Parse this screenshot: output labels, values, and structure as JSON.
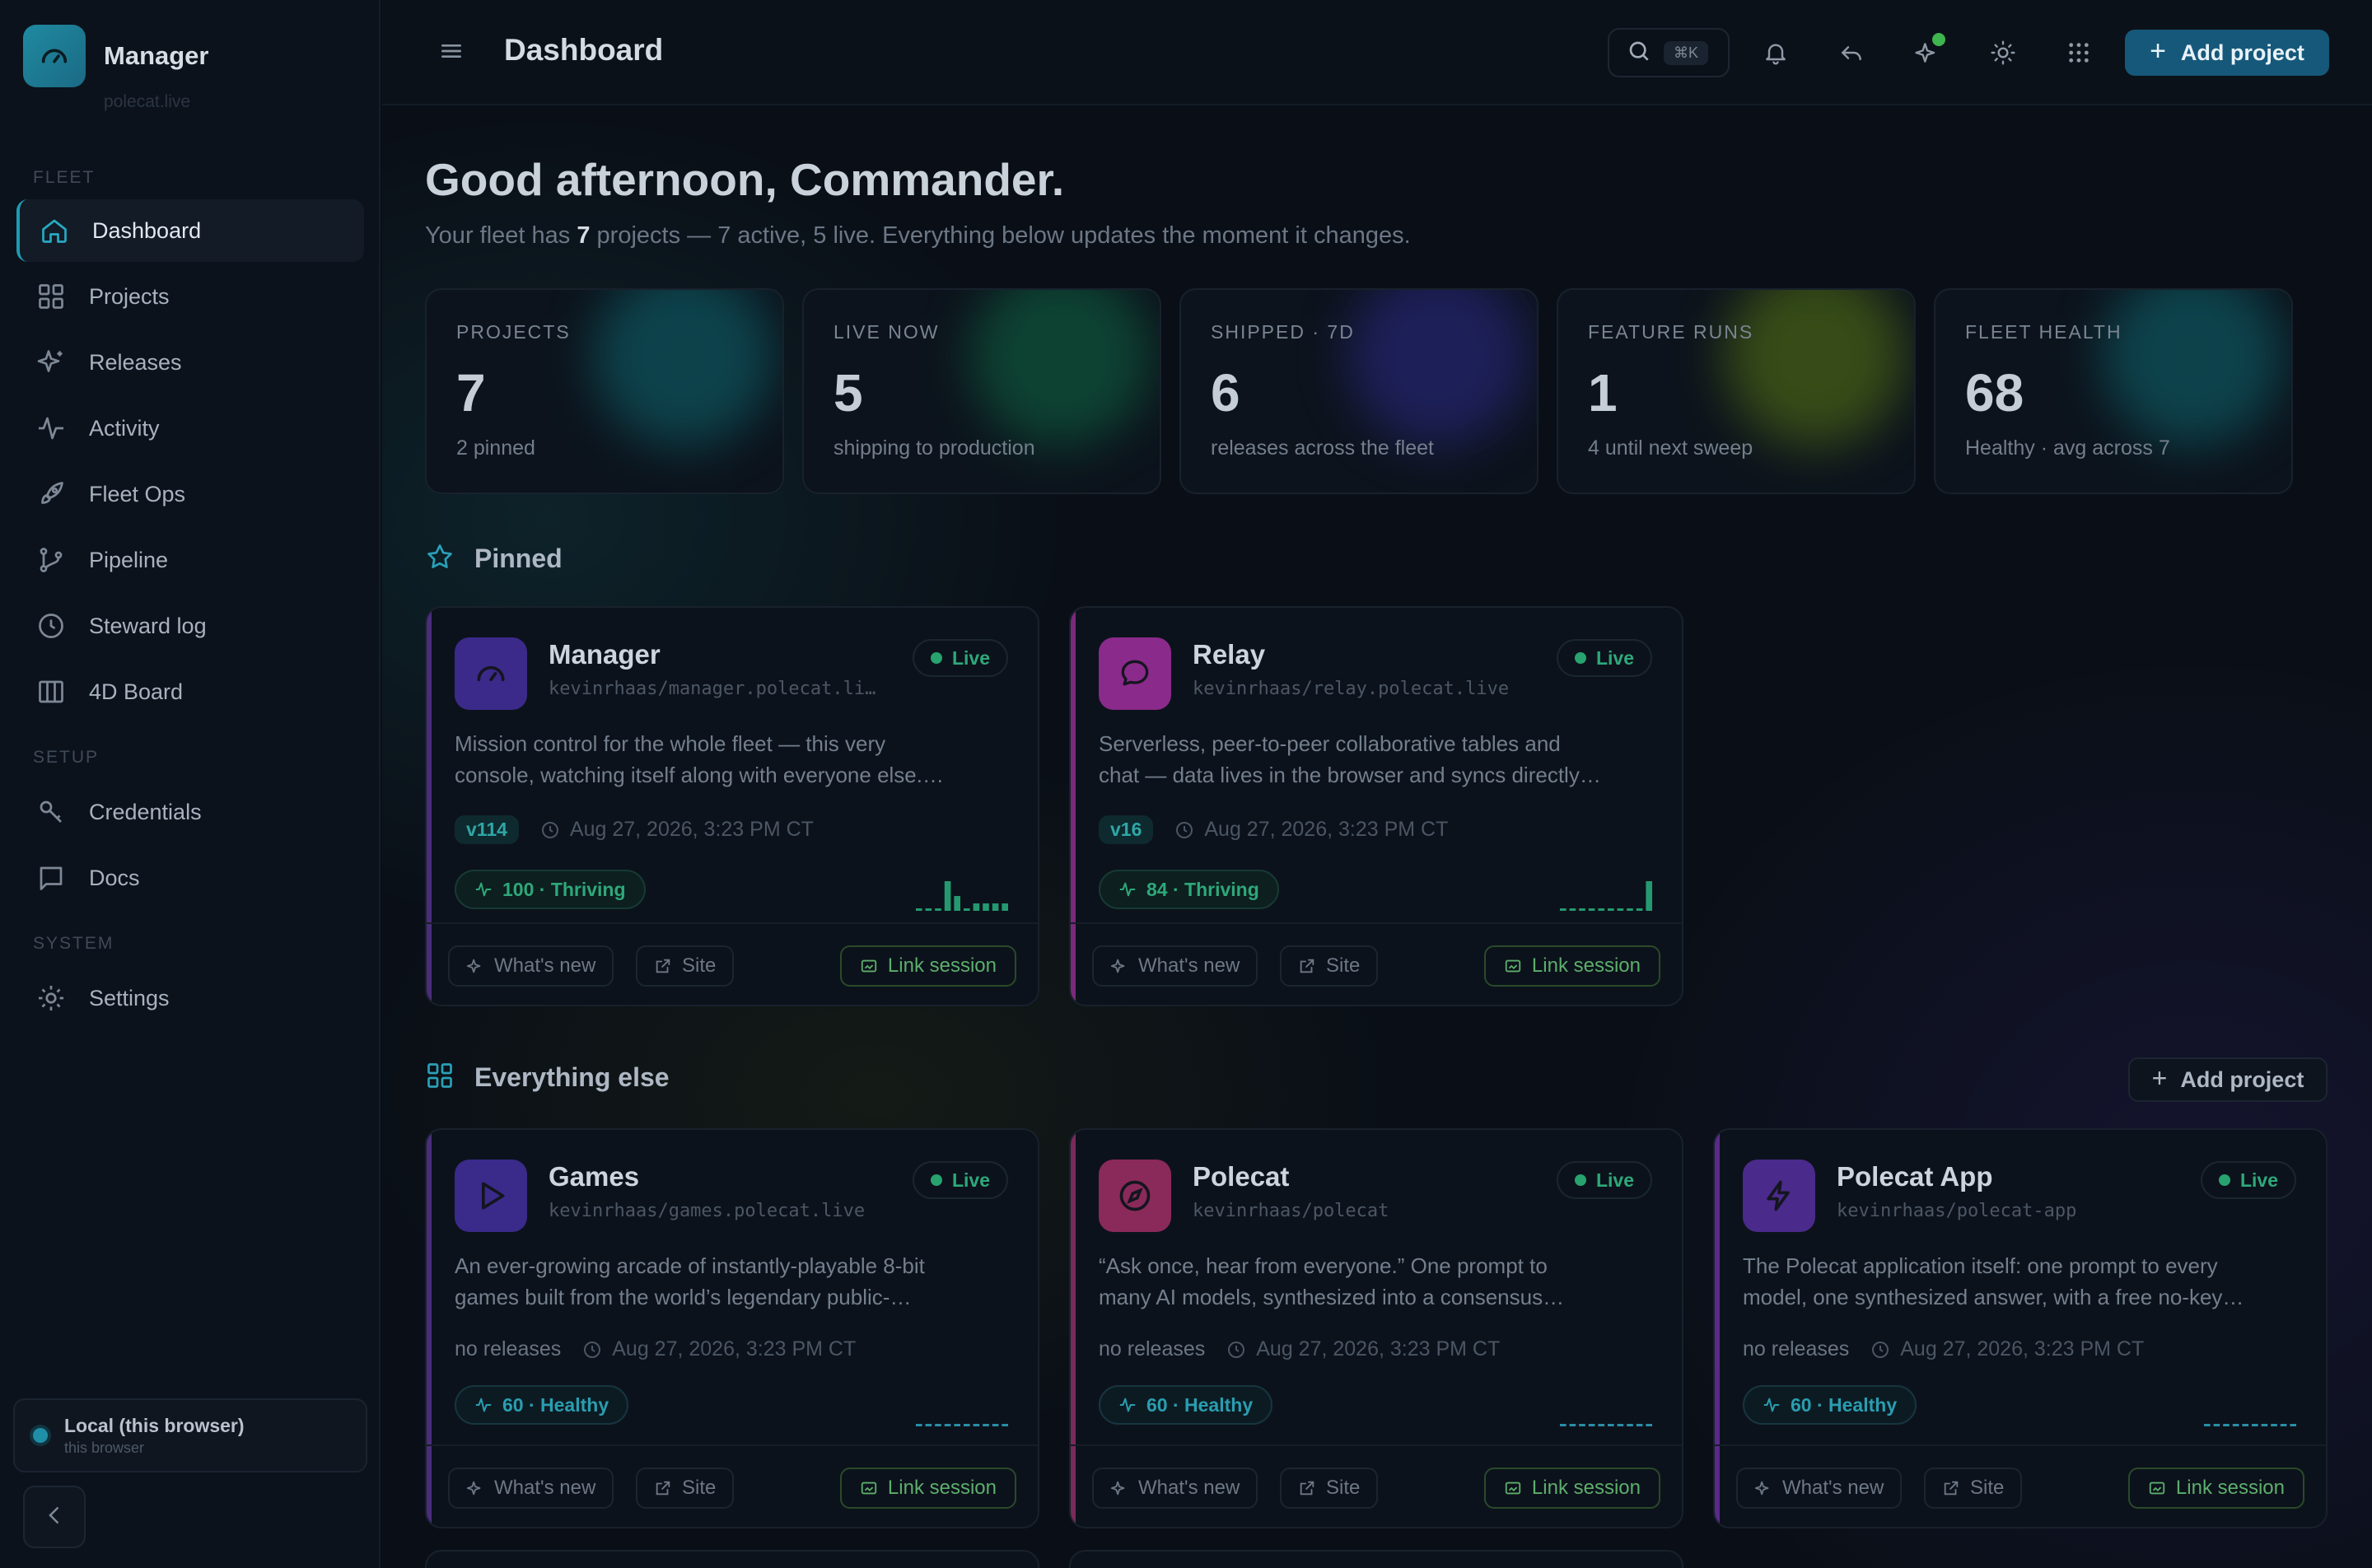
{
  "brand": {
    "name": "Manager",
    "sub": "polecat.live",
    "icon": "gauge-icon"
  },
  "nav": {
    "sections": {
      "fleet": "FLEET",
      "setup": "SETUP",
      "system": "SYSTEM"
    },
    "items": [
      {
        "label": "Dashboard",
        "icon": "home-icon",
        "active": true
      },
      {
        "label": "Projects",
        "icon": "grid-icon"
      },
      {
        "label": "Releases",
        "icon": "sparkle-icon"
      },
      {
        "label": "Activity",
        "icon": "activity-icon"
      },
      {
        "label": "Fleet Ops",
        "icon": "rocket-icon"
      },
      {
        "label": "Pipeline",
        "icon": "branch-icon"
      },
      {
        "label": "Steward log",
        "icon": "clock-icon"
      },
      {
        "label": "4D Board",
        "icon": "columns-icon"
      },
      {
        "label": "Credentials",
        "icon": "key-icon"
      },
      {
        "label": "Docs",
        "icon": "chat-square-icon"
      },
      {
        "label": "Settings",
        "icon": "gear-icon"
      }
    ]
  },
  "local": {
    "title": "Local (this browser)",
    "sub": "this browser"
  },
  "topbar": {
    "title": "Dashboard",
    "search_kbd": "⌘K",
    "add_project": "Add project"
  },
  "greeting": {
    "title": "Good afternoon, Commander.",
    "sub_pre": "Your fleet has ",
    "sub_count": "7",
    "sub_post": " projects — 7 active, 5 live. Everything below updates the moment it changes."
  },
  "stats": [
    {
      "label": "PROJECTS",
      "value": "7",
      "desc": "2 pinned",
      "glow": "#0f6a73"
    },
    {
      "label": "LIVE NOW",
      "value": "5",
      "desc": "shipping to production",
      "glow": "#0f6a45"
    },
    {
      "label": "SHIPPED · 7D",
      "value": "6",
      "desc": "releases across the fleet",
      "glow": "#2c2a8a"
    },
    {
      "label": "FEATURE RUNS",
      "value": "1",
      "desc": "4 until next sweep",
      "glow": "#5a7a14"
    },
    {
      "label": "FLEET HEALTH",
      "value": "68",
      "desc": "Healthy · avg across 7",
      "glow": "#0f6a73"
    }
  ],
  "sections": {
    "pinned": "Pinned",
    "else": "Everything else",
    "add_project": "Add project"
  },
  "buttons": {
    "whats_new": "What's new",
    "site": "Site",
    "link_session": "Link session"
  },
  "pinned": [
    {
      "name": "Manager",
      "repo": "kevinrhaas/manager.polecat.li…",
      "status": "Live",
      "desc1": "Mission control for the whole fleet — this very",
      "desc2": "console, watching itself along with everyone else.…",
      "version": "v114",
      "date": "Aug 27, 2026, 3:23 PM CT",
      "health": "100 · Thriving",
      "health_color": "#2ea87a",
      "accent": "#4a2d7a",
      "logo_bg": "#3b2a8a",
      "icon": "gauge-icon",
      "spark": [
        0,
        0,
        0,
        4,
        2,
        0,
        1,
        1,
        1,
        1
      ]
    },
    {
      "name": "Relay",
      "repo": "kevinrhaas/relay.polecat.live",
      "status": "Live",
      "desc1": "Serverless, peer-to-peer collaborative tables and",
      "desc2": "chat — data lives in the browser and syncs directly…",
      "version": "v16",
      "date": "Aug 27, 2026, 3:23 PM CT",
      "health": "84 · Thriving",
      "health_color": "#2ea87a",
      "accent": "#7a2a7a",
      "logo_bg": "#8a2a8a",
      "icon": "chat-bubble-icon",
      "spark": [
        0,
        0,
        0,
        0,
        0,
        0,
        0,
        0,
        0,
        4
      ]
    }
  ],
  "others": [
    {
      "name": "Games",
      "repo": "kevinrhaas/games.polecat.live",
      "status": "Live",
      "desc1": "An ever-growing arcade of instantly-playable 8-bit",
      "desc2": "games built from the world’s legendary public-…",
      "no_releases": "no releases",
      "date": "Aug 27, 2026, 3:23 PM CT",
      "health": "60 · Healthy",
      "health_color": "#2a9db0",
      "accent": "#4a2d7a",
      "logo_bg": "#3a2a8a",
      "icon": "play-icon",
      "spark": [
        0,
        0,
        0,
        0,
        0,
        0,
        0,
        0,
        0,
        0
      ]
    },
    {
      "name": "Polecat",
      "repo": "kevinrhaas/polecat",
      "status": "Live",
      "desc1": "“Ask once, hear from everyone.” One prompt to",
      "desc2": "many AI models, synthesized into a consensus…",
      "no_releases": "no releases",
      "date": "Aug 27, 2026, 3:23 PM CT",
      "health": "60 · Healthy",
      "health_color": "#2a9db0",
      "accent": "#7a2a5a",
      "logo_bg": "#8a2a5a",
      "icon": "compass-icon",
      "spark": [
        0,
        0,
        0,
        0,
        0,
        0,
        0,
        0,
        0,
        0
      ]
    },
    {
      "name": "Polecat App",
      "repo": "kevinrhaas/polecat-app",
      "status": "Live",
      "desc1": "The Polecat application itself: one prompt to every",
      "desc2": "model, one synthesized answer, with a free no-key…",
      "no_releases": "no releases",
      "date": "Aug 27, 2026, 3:23 PM CT",
      "health": "60 · Healthy",
      "health_color": "#2a9db0",
      "accent": "#5a2a8a",
      "logo_bg": "#4a2a8a",
      "icon": "bolt-icon",
      "spark": [
        0,
        0,
        0,
        0,
        0,
        0,
        0,
        0,
        0,
        0
      ]
    }
  ]
}
